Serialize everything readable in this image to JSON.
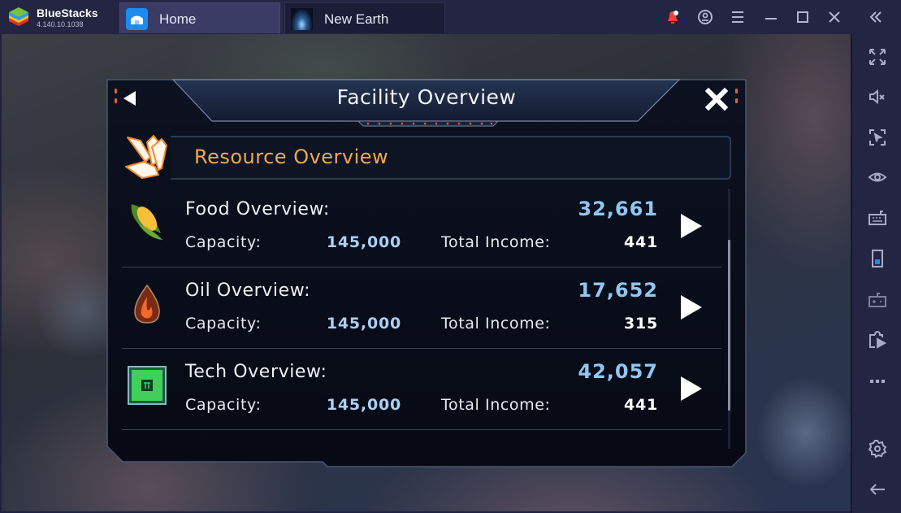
{
  "app": {
    "name": "BlueStacks",
    "version": "4.140.10.1038"
  },
  "tabs": [
    {
      "label": "Home",
      "icon": "home-icon",
      "active": false
    },
    {
      "label": "New Earth",
      "icon": "game-thumbnail-icon",
      "active": true
    }
  ],
  "titlebar_buttons": [
    "notification-bell-icon",
    "account-icon",
    "menu-icon",
    "minimize-icon",
    "maximize-icon",
    "close-icon",
    "collapse-sidebar-icon"
  ],
  "sidebar_buttons": [
    "fullscreen-icon",
    "mute-icon",
    "screenshot-pointer-icon",
    "eye-icon",
    "keyboard-icon",
    "phone-rotate-icon",
    "gamepad-icon",
    "media-manager-icon",
    "more-icon",
    "settings-icon",
    "back-arrow-icon"
  ],
  "colors": {
    "accent_orange": "#f3a84a",
    "amount_blue": "#8fc6f2",
    "capacity_blue": "#a9d0f5",
    "notification_red": "#f0433a"
  },
  "dialog": {
    "title": "Facility Overview",
    "section_title": "Resource Overview",
    "capacity_label": "Capacity:",
    "income_label": "Total Income:",
    "rows": [
      {
        "name": "Food Overview:",
        "icon": "corn-icon",
        "amount": "32,661",
        "capacity": "145,000",
        "income": "441"
      },
      {
        "name": "Oil Overview:",
        "icon": "oil-drop-icon",
        "amount": "17,652",
        "capacity": "145,000",
        "income": "315"
      },
      {
        "name": "Tech Overview:",
        "icon": "chip-icon",
        "amount": "42,057",
        "capacity": "145,000",
        "income": "441"
      }
    ]
  }
}
